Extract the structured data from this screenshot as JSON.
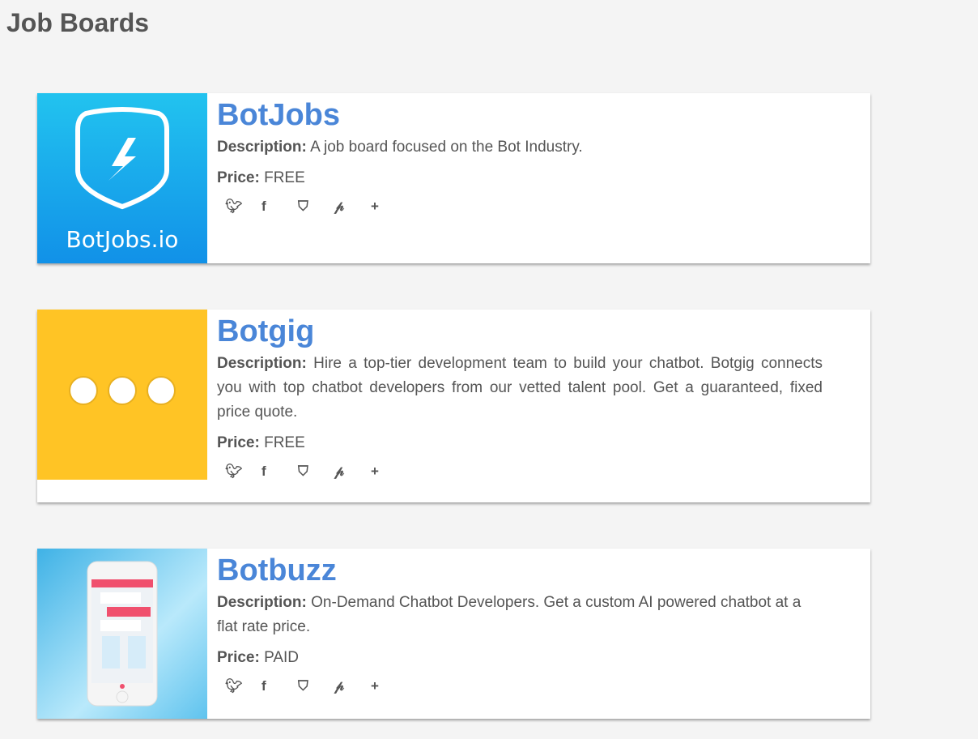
{
  "page_title": "Job Boards",
  "labels": {
    "description": "Description:",
    "price": "Price:"
  },
  "boards": [
    {
      "name": "BotJobs",
      "description": "A job board focused on the Bot Industry.",
      "price": "FREE",
      "logo_text": "BotJobs.io"
    },
    {
      "name": "Botgig",
      "description": "Hire a top-tier development team to build your chatbot. Botgig connects you with top chatbot developers from our vetted talent pool. Get a guaranteed, fixed price quote.",
      "price": "FREE"
    },
    {
      "name": "Botbuzz",
      "description": "On-Demand Chatbot Developers. Get a custom AI powered chatbot at a flat rate price.",
      "price": "PAID"
    }
  ],
  "share_icons": [
    "twitter-icon",
    "facebook-icon",
    "pocket-icon",
    "pinterest-icon",
    "plus-icon"
  ],
  "colors": {
    "accent": "#4a86d8",
    "botgig_bg": "#ffc425"
  }
}
